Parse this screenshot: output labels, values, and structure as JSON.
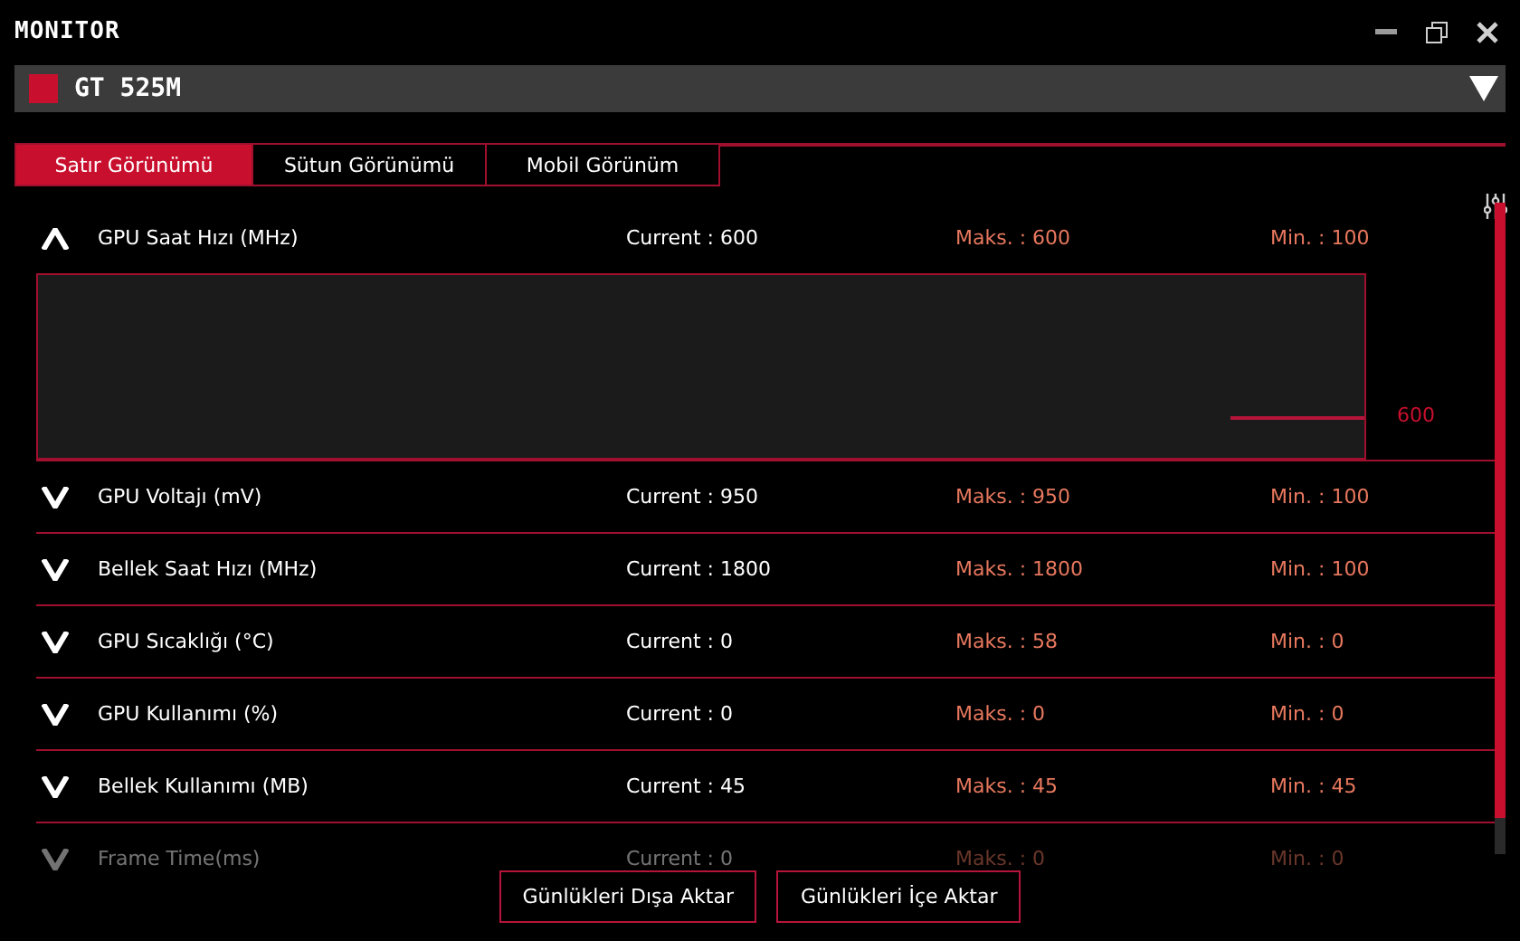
{
  "window": {
    "title": "MONITOR"
  },
  "device": {
    "name": "GT 525M"
  },
  "tabs": [
    {
      "label": "Satır Görünümü",
      "selected": true
    },
    {
      "label": "Sütun Görünümü",
      "selected": false
    },
    {
      "label": "Mobil Görünüm",
      "selected": false
    }
  ],
  "rows": [
    {
      "name": "GPU Saat Hızı (MHz)",
      "current": "Current : 600",
      "max": "Maks. : 600",
      "min": "Min. : 100",
      "expanded": true,
      "faded": false,
      "graph_label": "600"
    },
    {
      "name": "GPU Voltajı (mV)",
      "current": "Current : 950",
      "max": "Maks. : 950",
      "min": "Min. : 100",
      "expanded": false,
      "faded": false
    },
    {
      "name": "Bellek Saat Hızı (MHz)",
      "current": "Current : 1800",
      "max": "Maks. : 1800",
      "min": "Min. : 100",
      "expanded": false,
      "faded": false
    },
    {
      "name": "GPU Sıcaklığı (°C)",
      "current": "Current : 0",
      "max": "Maks. : 58",
      "min": "Min. : 0",
      "expanded": false,
      "faded": false
    },
    {
      "name": "GPU Kullanımı (%)",
      "current": "Current : 0",
      "max": "Maks. : 0",
      "min": "Min. : 0",
      "expanded": false,
      "faded": false
    },
    {
      "name": "Bellek Kullanımı (MB)",
      "current": "Current : 45",
      "max": "Maks. : 45",
      "min": "Min. : 45",
      "expanded": false,
      "faded": false
    },
    {
      "name": "Frame Time(ms)",
      "current": "Current : 0",
      "max": "Maks. : 0",
      "min": "Min. : 0",
      "expanded": false,
      "faded": true
    }
  ],
  "buttons": [
    {
      "label": "Günlükleri Dışa Aktar"
    },
    {
      "label": "Günlükleri İçe Aktar"
    }
  ]
}
